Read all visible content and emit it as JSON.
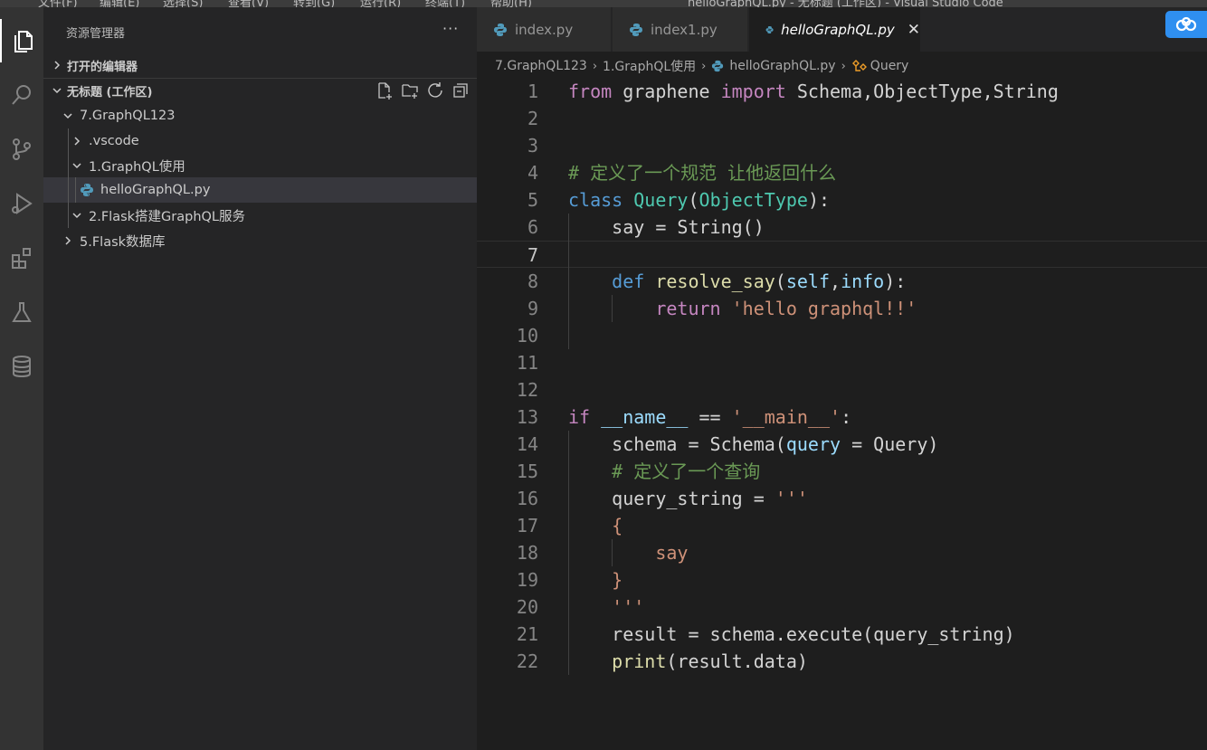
{
  "menubar": {
    "items": [
      "文件(F)",
      "编辑(E)",
      "选择(S)",
      "查看(V)",
      "转到(G)",
      "运行(R)",
      "终端(T)",
      "帮助(H)"
    ],
    "window_title": "helloGraphQL.py - 无标题 (工作区) - Visual Studio Code"
  },
  "activitybar": {
    "icons": [
      "explorer-icon",
      "search-icon",
      "source-control-icon",
      "run-debug-icon",
      "extensions-icon",
      "testing-icon",
      "database-icon"
    ]
  },
  "sidebar": {
    "title": "资源管理器",
    "more": "···",
    "open_editors_label": "打开的编辑器",
    "workspace_label": "无标题 (工作区)",
    "tree": [
      {
        "label": "7.GraphQL123",
        "type": "folder",
        "expanded": true
      },
      {
        "label": ".vscode",
        "type": "folder",
        "expanded": false
      },
      {
        "label": "1.GraphQL使用",
        "type": "folder",
        "expanded": true
      },
      {
        "label": "helloGraphQL.py",
        "type": "file",
        "selected": true
      },
      {
        "label": "2.Flask搭建GraphQL服务",
        "type": "folder",
        "expanded": true
      },
      {
        "label": "5.Flask数据库",
        "type": "folder",
        "expanded": false
      }
    ]
  },
  "tabs": [
    {
      "label": "index.py",
      "active": false
    },
    {
      "label": "index1.py",
      "active": false
    },
    {
      "label": "helloGraphQL.py",
      "active": true
    }
  ],
  "tab_close": "✕",
  "breadcrumb": [
    "7.GraphQL123",
    "1.GraphQL使用",
    "helloGraphQL.py",
    "Query"
  ],
  "current_line": 7,
  "code": [
    {
      "n": "1",
      "t": [
        [
          "kw",
          "from"
        ],
        [
          "pl",
          " graphene "
        ],
        [
          "kw",
          "import"
        ],
        [
          "pl",
          " Schema,ObjectType,String"
        ]
      ]
    },
    {
      "n": "2",
      "t": []
    },
    {
      "n": "3",
      "t": []
    },
    {
      "n": "4",
      "t": [
        [
          "cmt",
          "# 定义了一个规范 让他返回什么"
        ]
      ]
    },
    {
      "n": "5",
      "t": [
        [
          "blue",
          "class"
        ],
        [
          "pl",
          " "
        ],
        [
          "cls",
          "Query"
        ],
        [
          "pl",
          "("
        ],
        [
          "cls",
          "ObjectType"
        ],
        [
          "pl",
          "):"
        ]
      ]
    },
    {
      "n": "6",
      "t": [
        [
          "pl",
          "    say = String()"
        ]
      ]
    },
    {
      "n": "7",
      "t": []
    },
    {
      "n": "8",
      "t": [
        [
          "pl",
          "    "
        ],
        [
          "blue",
          "def"
        ],
        [
          "pl",
          " "
        ],
        [
          "fn",
          "resolve_say"
        ],
        [
          "pl",
          "("
        ],
        [
          "var",
          "self"
        ],
        [
          "pl",
          ","
        ],
        [
          "var",
          "info"
        ],
        [
          "pl",
          "):"
        ]
      ]
    },
    {
      "n": "9",
      "t": [
        [
          "pl",
          "        "
        ],
        [
          "kw",
          "return"
        ],
        [
          "pl",
          " "
        ],
        [
          "str",
          "'hello graphql!!'"
        ]
      ]
    },
    {
      "n": "10",
      "t": []
    },
    {
      "n": "11",
      "t": []
    },
    {
      "n": "12",
      "t": []
    },
    {
      "n": "13",
      "t": [
        [
          "kw",
          "if"
        ],
        [
          "pl",
          " "
        ],
        [
          "var",
          "__name__"
        ],
        [
          "pl",
          " == "
        ],
        [
          "str",
          "'__main__'"
        ],
        [
          "pl",
          ":"
        ]
      ]
    },
    {
      "n": "14",
      "t": [
        [
          "pl",
          "    schema = Schema("
        ],
        [
          "var",
          "query"
        ],
        [
          "pl",
          " = Query)"
        ]
      ]
    },
    {
      "n": "15",
      "t": [
        [
          "pl",
          "    "
        ],
        [
          "cmt",
          "# 定义了一个查询"
        ]
      ]
    },
    {
      "n": "16",
      "t": [
        [
          "pl",
          "    query_string = "
        ],
        [
          "str",
          "'''"
        ]
      ]
    },
    {
      "n": "17",
      "t": [
        [
          "pl",
          "    "
        ],
        [
          "str",
          "{"
        ]
      ]
    },
    {
      "n": "18",
      "t": [
        [
          "pl",
          "        "
        ],
        [
          "str",
          "say"
        ]
      ]
    },
    {
      "n": "19",
      "t": [
        [
          "pl",
          "    "
        ],
        [
          "str",
          "}"
        ]
      ]
    },
    {
      "n": "20",
      "t": [
        [
          "pl",
          "    "
        ],
        [
          "str",
          "'''"
        ]
      ]
    },
    {
      "n": "21",
      "t": [
        [
          "pl",
          "    result = schema.execute(query_string)"
        ]
      ]
    },
    {
      "n": "22",
      "t": [
        [
          "pl",
          "    "
        ],
        [
          "fn",
          "print"
        ],
        [
          "pl",
          "(result.data)"
        ]
      ]
    }
  ],
  "colors": {
    "keyword": "#c586c0",
    "storage": "#569cd6",
    "class": "#4ec9b0",
    "function": "#dcdcaa",
    "variable": "#9cdcfe",
    "string": "#ce9178",
    "comment": "#6a9955",
    "python_icon": "#519aba",
    "symbol_icon": "#ee9d28",
    "cloud_button": "#2f8ff0"
  }
}
